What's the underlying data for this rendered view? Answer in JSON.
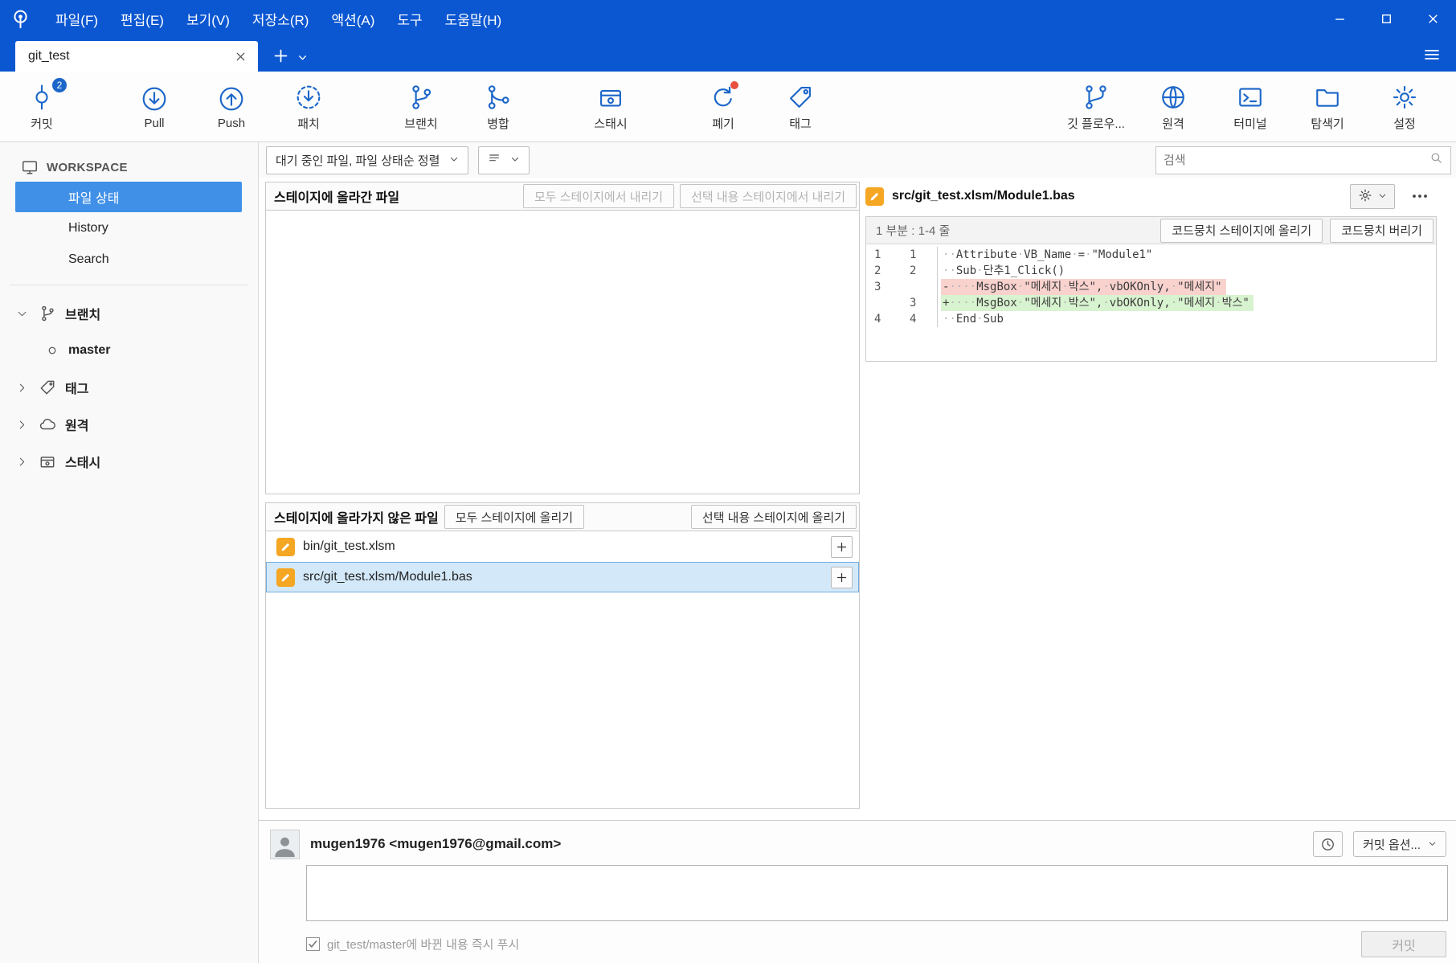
{
  "titlebar": {
    "menus": [
      "파일(F)",
      "편집(E)",
      "보기(V)",
      "저장소(R)",
      "액션(A)",
      "도구",
      "도움말(H)"
    ]
  },
  "tabbar": {
    "active_tab": "git_test"
  },
  "toolbar": {
    "items_left": [
      {
        "label": "커밋",
        "badge": "2"
      },
      {
        "label": "Pull"
      },
      {
        "label": "Push"
      },
      {
        "label": "패치"
      },
      {
        "label": "브랜치"
      },
      {
        "label": "병합"
      },
      {
        "label": "스태시"
      },
      {
        "label": "폐기"
      },
      {
        "label": "태그"
      }
    ],
    "items_right": [
      {
        "label": "깃 플로우..."
      },
      {
        "label": "원격"
      },
      {
        "label": "터미널"
      },
      {
        "label": "탐색기"
      },
      {
        "label": "설정"
      }
    ]
  },
  "sidebar": {
    "workspace_label": "WORKSPACE",
    "file_status": "파일 상태",
    "history": "History",
    "search": "Search",
    "branches_label": "브랜치",
    "current_branch": "master",
    "tags_label": "태그",
    "remotes_label": "원격",
    "stashes_label": "스태시"
  },
  "filter_bar": {
    "sort_dropdown": "대기 중인 파일, 파일 상태순 정렬",
    "search_placeholder": "검색"
  },
  "staged": {
    "title": "스테이지에 올라간 파일",
    "unstage_all_button": "모두 스테이지에서 내리기",
    "unstage_selected_button": "선택 내용 스테이지에서 내리기",
    "files": []
  },
  "unstaged": {
    "title": "스테이지에 올라가지 않은 파일",
    "stage_all_button": "모두 스테이지에 올리기",
    "stage_selected_button": "선택 내용 스테이지에 올리기",
    "files": [
      {
        "name": "bin/git_test.xlsm",
        "status": "modified",
        "selected": false
      },
      {
        "name": "src/git_test.xlsm/Module1.bas",
        "status": "modified",
        "selected": true
      }
    ]
  },
  "diff": {
    "filename": "src/git_test.xlsm/Module1.bas",
    "hunk_label": "1 부분 : 1-4 줄",
    "stage_hunk_button": "코드뭉치 스테이지에 올리기",
    "discard_hunk_button": "코드뭉치 버리기",
    "lines": [
      {
        "old": "1",
        "new": "1",
        "type": "context",
        "text": "··Attribute·VB_Name·=·\"Module1\""
      },
      {
        "old": "2",
        "new": "2",
        "type": "context",
        "text": "··Sub·단추1_Click()"
      },
      {
        "old": "3",
        "new": "",
        "type": "removed",
        "text": "-····MsgBox·\"메세지·박스\",·vbOKOnly,·\"메세지\""
      },
      {
        "old": "",
        "new": "3",
        "type": "added",
        "text": "+····MsgBox·\"메세지·박스\",·vbOKOnly,·\"메세지·박스\""
      },
      {
        "old": "4",
        "new": "4",
        "type": "context",
        "text": "··End·Sub"
      }
    ]
  },
  "commit": {
    "author": "mugen1976 <mugen1976@gmail.com>",
    "options_button": "커밋 옵션...",
    "push_checkbox_label": "git_test/master에 바뀐 내용 즉시 푸시",
    "push_checkbox_checked": true,
    "commit_button": "커밋",
    "message_value": ""
  },
  "colors": {
    "titlebar_blue": "#0b57d2",
    "icon_blue": "#1b66c9",
    "selected_sidebar_blue": "#4190e8",
    "selected_row_blue": "#d3e9fa",
    "modified_icon_orange": "#f5a623",
    "diff_removed_bg": "#f9d2ce",
    "diff_added_bg": "#d8f3cf"
  }
}
